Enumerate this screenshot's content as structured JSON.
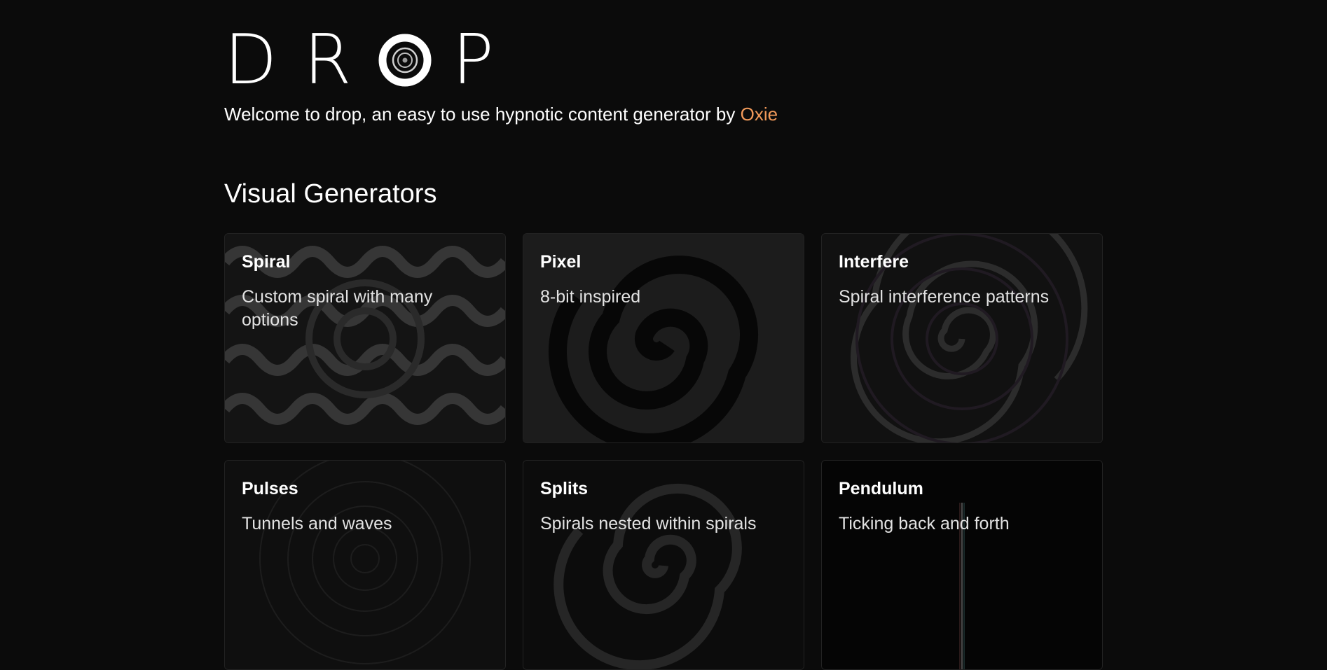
{
  "header": {
    "logo_letters": [
      "D",
      "R",
      "P"
    ],
    "tagline_prefix": "Welcome to drop, an easy to use hypnotic content generator by ",
    "tagline_link": "Oxie",
    "link_color": "#f29a5a"
  },
  "section": {
    "title": "Visual Generators"
  },
  "cards": [
    {
      "title": "Spiral",
      "description": "Custom spiral with many options"
    },
    {
      "title": "Pixel",
      "description": "8-bit inspired"
    },
    {
      "title": "Interfere",
      "description": "Spiral interference patterns"
    },
    {
      "title": "Pulses",
      "description": "Tunnels and waves"
    },
    {
      "title": "Splits",
      "description": "Spirals nested within spirals"
    },
    {
      "title": "Pendulum",
      "description": "Ticking back and forth"
    }
  ],
  "colors": {
    "background": "#0b0b0b",
    "card_background": "#151515",
    "accent": "#f29a5a"
  }
}
